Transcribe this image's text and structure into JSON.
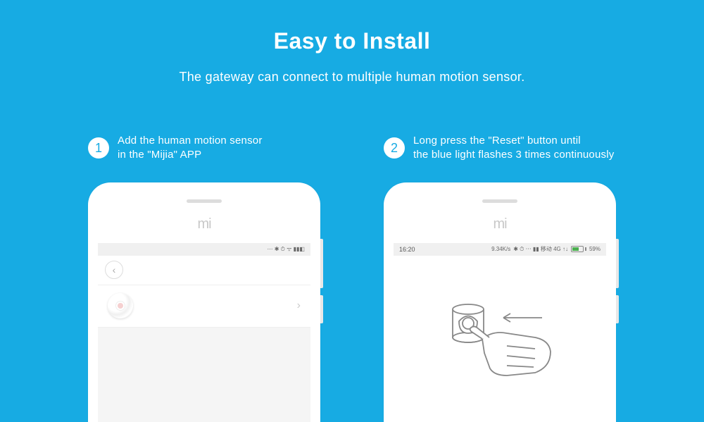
{
  "title": "Easy to Install",
  "subtitle": "The gateway can connect to multiple human motion sensor.",
  "steps": [
    {
      "number": "1",
      "line1": "Add the human motion sensor",
      "line2": " in the \"Mijia\" APP"
    },
    {
      "number": "2",
      "line1": "Long press the \"Reset\" button until",
      "line2": "the blue light flashes 3 times continuously"
    }
  ],
  "phone": {
    "logo": "mi",
    "statusbar1": {
      "indicators": "⋯ ✱ ⏱ ᯤ ▮▮◧"
    },
    "statusbar2": {
      "time": "16:20",
      "speed": "9.34K/s",
      "indicators": "✱ ⏱ ⋯ ▮▮ 移动 4G ↑↓",
      "battery_pct": "59%"
    },
    "screen1": {
      "back_icon": "‹",
      "chevron": "›"
    }
  }
}
